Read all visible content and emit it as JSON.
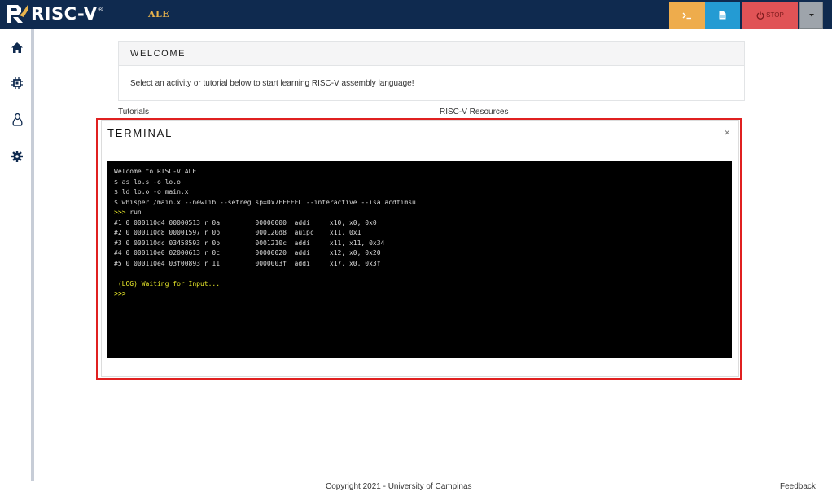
{
  "header": {
    "logo_text": "RISC-V",
    "logo_reg": "®",
    "app_name": "ALE",
    "stop_label": "STOP",
    "colors": {
      "bar": "#0f2a4f",
      "terminal_btn": "#eeac4c",
      "file_btn": "#249bd3",
      "stop_btn": "#e05356",
      "more_btn": "#9ea4ab"
    },
    "icons": {
      "terminal": "terminal-icon",
      "file": "file-icon",
      "stop": "power-icon",
      "more": "caret-down-icon"
    }
  },
  "sidebar": {
    "items": [
      {
        "icon": "home-icon"
      },
      {
        "icon": "chip-icon"
      },
      {
        "icon": "linux-icon"
      },
      {
        "icon": "gear-icon"
      }
    ]
  },
  "welcome": {
    "title": "WELCOME",
    "body": "Select an activity or tutorial below to start learning RISC-V assembly language!"
  },
  "sections": {
    "tutorials": "Tutorials",
    "resources": "RISC-V Resources"
  },
  "terminal_modal": {
    "title": "TERMINAL",
    "close": "×",
    "lines": [
      {
        "text": "Welcome to RISC-V ALE",
        "color": "normal"
      },
      {
        "text": "$ as lo.s -o lo.o",
        "color": "normal"
      },
      {
        "text": "$ ld lo.o -o main.x",
        "color": "normal"
      },
      {
        "text": "$ whisper /main.x --newlib --setreg sp=0x7FFFFFC --interactive --isa acdfimsu",
        "color": "normal"
      },
      {
        "text": ">>> run",
        "color": "prompt"
      },
      {
        "text": "#1 0 000110d4 00000513 r 0a         00000000  addi     x10, x0, 0x0",
        "color": "normal"
      },
      {
        "text": "#2 0 000110d8 00001597 r 0b         000120d8  auipc    x11, 0x1",
        "color": "normal"
      },
      {
        "text": "#3 0 000110dc 03458593 r 0b         0001210c  addi     x11, x11, 0x34",
        "color": "normal"
      },
      {
        "text": "#4 0 000110e0 02000613 r 0c         00000020  addi     x12, x0, 0x20",
        "color": "normal"
      },
      {
        "text": "#5 0 000110e4 03f00893 r 11         0000003f  addi     x17, x0, 0x3f",
        "color": "normal"
      },
      {
        "text": "",
        "color": "normal"
      },
      {
        "text": " (LOG) Waiting for Input...",
        "color": "yellow"
      },
      {
        "text": ">>>",
        "color": "yellow"
      }
    ]
  },
  "footer": {
    "copyright": "Copyright 2021 - University of Campinas",
    "feedback": "Feedback"
  }
}
